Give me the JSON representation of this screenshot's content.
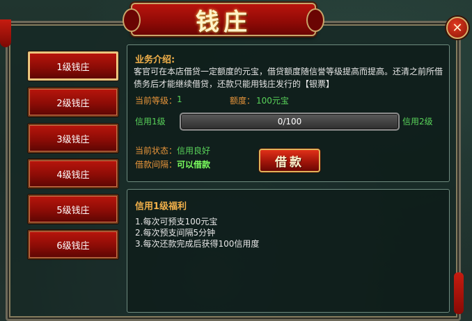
{
  "window": {
    "title": "钱庄",
    "close_label": "✕"
  },
  "sidebar": {
    "items": [
      {
        "label": "1级钱庄",
        "active": true
      },
      {
        "label": "2级钱庄",
        "active": false
      },
      {
        "label": "3级钱庄",
        "active": false
      },
      {
        "label": "4级钱庄",
        "active": false
      },
      {
        "label": "5级钱庄",
        "active": false
      },
      {
        "label": "6级钱庄",
        "active": false
      }
    ]
  },
  "intro": {
    "title": "业务介绍:",
    "text": "客官可在本店借贷一定额度的元宝，借贷额度随信誉等级提高而提高。还清之前所借债务后才能继续借贷，还款只能用钱庄发行的【银票】"
  },
  "status": {
    "level_label": "当前等级：",
    "level_value": "1",
    "quota_label": "额度：",
    "quota_value": "100元宝",
    "credit_left": "信用1级",
    "credit_right": "信用2级",
    "progress_text": "0/100",
    "progress_fraction": 0.0,
    "state_label": "当前状态：",
    "state_value": "信用良好",
    "interval_label": "借款间隔：",
    "interval_value": "可以借款"
  },
  "loan_button": {
    "label": "借款"
  },
  "benefits": {
    "title": "信用1级福利",
    "items": [
      "1.每次可预支100元宝",
      "2.每次预支间隔5分钟",
      "3.每次还款完成后获得100信用度"
    ]
  },
  "colors": {
    "accent_orange": "#f2b04a",
    "status_green": "#59d35a",
    "button_red": "#a2150a"
  }
}
